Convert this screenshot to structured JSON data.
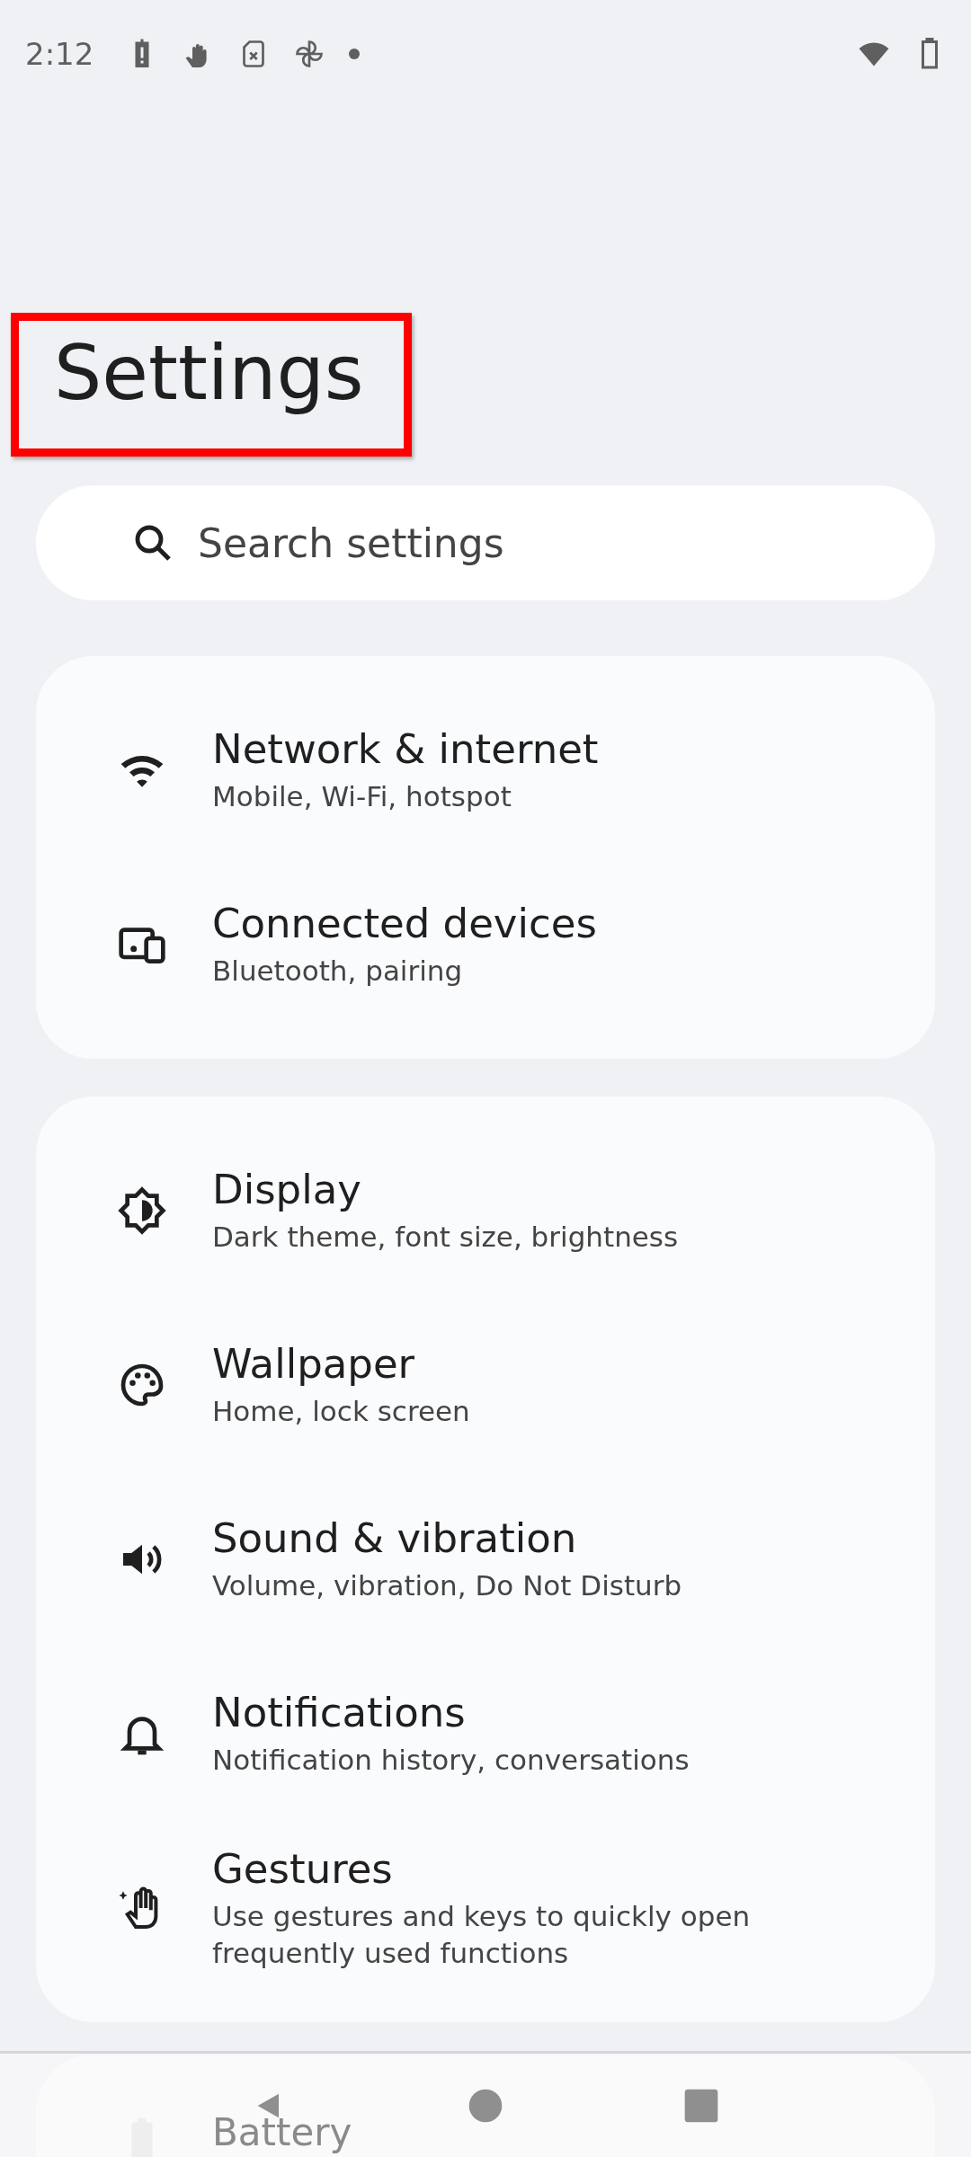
{
  "status_bar": {
    "time": "2:12"
  },
  "title": {
    "text": "Settings",
    "highlighted": true
  },
  "search": {
    "placeholder": "Search settings"
  },
  "groups": [
    {
      "items": [
        {
          "title": "Network & internet",
          "subtitle": "Mobile, Wi-Fi, hotspot"
        },
        {
          "title": "Connected devices",
          "subtitle": "Bluetooth, pairing"
        }
      ]
    },
    {
      "items": [
        {
          "title": "Display",
          "subtitle": "Dark theme, font size, brightness"
        },
        {
          "title": "Wallpaper",
          "subtitle": "Home, lock screen"
        },
        {
          "title": "Sound & vibration",
          "subtitle": "Volume, vibration, Do Not Disturb"
        },
        {
          "title": "Notifications",
          "subtitle": "Notification history, conversations"
        },
        {
          "title": "Gestures",
          "subtitle": "Use gestures and keys to quickly open frequently used functions"
        }
      ]
    },
    {
      "items": [
        {
          "title": "Battery"
        }
      ]
    }
  ]
}
